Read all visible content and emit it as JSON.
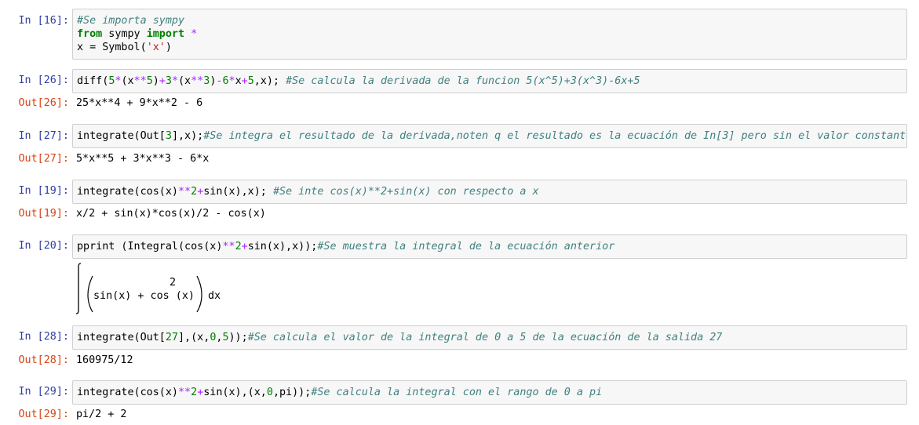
{
  "cells": [
    {
      "in_prompt": "In [16]:",
      "lines": [
        [
          {
            "t": "#Se importa sympy",
            "c": "cm"
          }
        ],
        [
          {
            "t": "from",
            "c": "kw"
          },
          {
            "t": " sympy "
          },
          {
            "t": "import",
            "c": "kw"
          },
          {
            "t": " "
          },
          {
            "t": "*",
            "c": "op"
          }
        ],
        [
          {
            "t": "x = Symbol("
          },
          {
            "t": "'x'",
            "c": "st"
          },
          {
            "t": ")"
          }
        ]
      ]
    },
    {
      "in_prompt": "In [26]:",
      "lines": [
        [
          {
            "t": "diff("
          },
          {
            "t": "5",
            "c": "nm"
          },
          {
            "t": "*",
            "c": "op"
          },
          {
            "t": "(x"
          },
          {
            "t": "**",
            "c": "op"
          },
          {
            "t": "5",
            "c": "nm"
          },
          {
            "t": ")"
          },
          {
            "t": "+",
            "c": "op"
          },
          {
            "t": "3",
            "c": "nm"
          },
          {
            "t": "*",
            "c": "op"
          },
          {
            "t": "(x"
          },
          {
            "t": "**",
            "c": "op"
          },
          {
            "t": "3",
            "c": "nm"
          },
          {
            "t": ")"
          },
          {
            "t": "-",
            "c": "op"
          },
          {
            "t": "6",
            "c": "nm"
          },
          {
            "t": "*",
            "c": "op"
          },
          {
            "t": "x"
          },
          {
            "t": "+",
            "c": "op"
          },
          {
            "t": "5",
            "c": "nm"
          },
          {
            "t": ",x); "
          },
          {
            "t": "#Se calcula la derivada de la funcion 5(x^5)+3(x^3)-6x+5",
            "c": "cm"
          }
        ]
      ],
      "out_prompt": "Out[26]:",
      "output": "25*x**4 + 9*x**2 - 6"
    },
    {
      "in_prompt": "In [27]:",
      "lines": [
        [
          {
            "t": "integrate(Out["
          },
          {
            "t": "3",
            "c": "nm"
          },
          {
            "t": "],x);"
          },
          {
            "t": "#Se integra el resultado de la derivada,noten q el resultado es la ecuación de In[3] pero sin el valor constante",
            "c": "cm"
          }
        ]
      ],
      "out_prompt": "Out[27]:",
      "output": "5*x**5 + 3*x**3 - 6*x"
    },
    {
      "in_prompt": "In [19]:",
      "lines": [
        [
          {
            "t": "integrate(cos(x)"
          },
          {
            "t": "**",
            "c": "op"
          },
          {
            "t": "2",
            "c": "nm"
          },
          {
            "t": "+",
            "c": "op"
          },
          {
            "t": "sin(x),x); "
          },
          {
            "t": "#Se inte cos(x)**2+sin(x) con respecto a x",
            "c": "cm"
          }
        ]
      ],
      "out_prompt": "Out[19]:",
      "output": "x/2 + sin(x)*cos(x)/2 - cos(x)"
    },
    {
      "in_prompt": "In [20]:",
      "lines": [
        [
          {
            "t": "pprint (Integral(cos(x)"
          },
          {
            "t": "**",
            "c": "op"
          },
          {
            "t": "2",
            "c": "nm"
          },
          {
            "t": "+",
            "c": "op"
          },
          {
            "t": "sin(x),x));"
          },
          {
            "t": "#Se muestra la integral de la ecuación anterior",
            "c": "cm"
          }
        ]
      ],
      "pretty": {
        "superscript": "2",
        "body": "sin(x) + cos (x)",
        "dx": "dx"
      }
    },
    {
      "in_prompt": "In [28]:",
      "lines": [
        [
          {
            "t": "integrate(Out["
          },
          {
            "t": "27",
            "c": "nm"
          },
          {
            "t": "],(x,"
          },
          {
            "t": "0",
            "c": "nm"
          },
          {
            "t": ","
          },
          {
            "t": "5",
            "c": "nm"
          },
          {
            "t": "));"
          },
          {
            "t": "#Se calcula el valor de la integral de 0 a 5 de la ecuación de la salida 27",
            "c": "cm"
          }
        ]
      ],
      "out_prompt": "Out[28]:",
      "output": "160975/12"
    },
    {
      "in_prompt": "In [29]:",
      "lines": [
        [
          {
            "t": "integrate(cos(x)"
          },
          {
            "t": "**",
            "c": "op"
          },
          {
            "t": "2",
            "c": "nm"
          },
          {
            "t": "+",
            "c": "op"
          },
          {
            "t": "sin(x),(x,"
          },
          {
            "t": "0",
            "c": "nm"
          },
          {
            "t": ",pi));"
          },
          {
            "t": "#Se calcula la integral con el rango de 0 a pi",
            "c": "cm"
          }
        ]
      ],
      "out_prompt": "Out[29]:",
      "output": "pi/2 + 2"
    }
  ]
}
